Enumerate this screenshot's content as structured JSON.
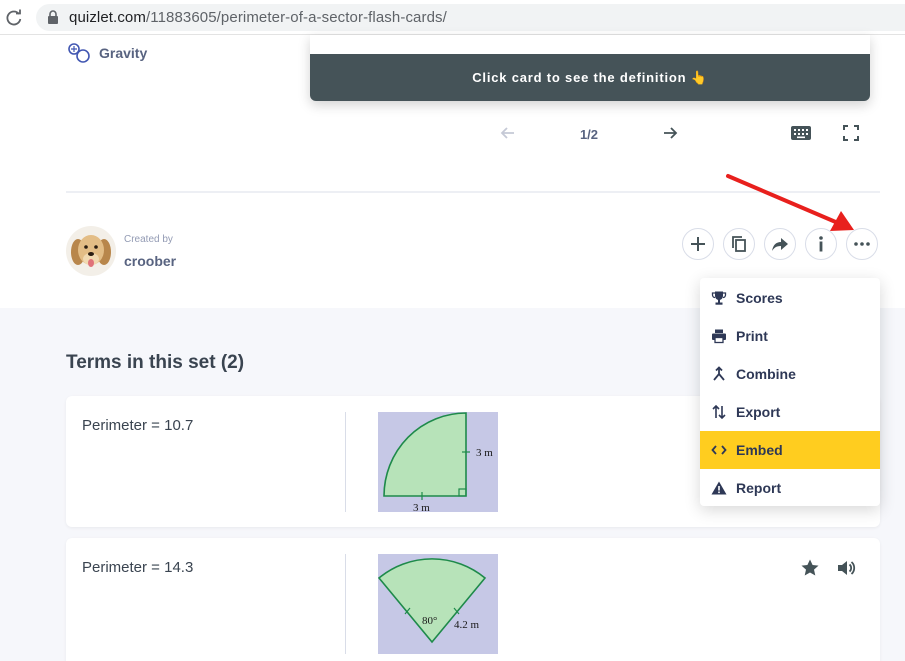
{
  "browser": {
    "url_host": "quizlet.com",
    "url_path": "/11883605/perimeter-of-a-sector-flash-cards/"
  },
  "sidebar": {
    "gravity_label": "Gravity"
  },
  "flashcard": {
    "hint": "Click card to see the definition 👆",
    "counter": "1/2"
  },
  "creator": {
    "created_by_label": "Created by",
    "username": "croober"
  },
  "menu": {
    "items": [
      {
        "label": "Scores",
        "icon": "trophy-icon"
      },
      {
        "label": "Print",
        "icon": "printer-icon"
      },
      {
        "label": "Combine",
        "icon": "merge-icon"
      },
      {
        "label": "Export",
        "icon": "swap-vertical-icon"
      },
      {
        "label": "Embed",
        "icon": "code-icon",
        "active": true
      },
      {
        "label": "Report",
        "icon": "warning-icon"
      }
    ]
  },
  "terms": {
    "heading": "Terms in this set (2)",
    "items": [
      {
        "term": "Perimeter = 10.7",
        "img_labels": [
          "3 m",
          "3 m"
        ]
      },
      {
        "term": "Perimeter = 14.3",
        "img_labels": [
          "80°",
          "4.2 m"
        ]
      }
    ]
  },
  "colors": {
    "accent_yellow": "#ffcd1f",
    "card_hint_bg": "#455358",
    "annotation_arrow": "#e8201d"
  }
}
